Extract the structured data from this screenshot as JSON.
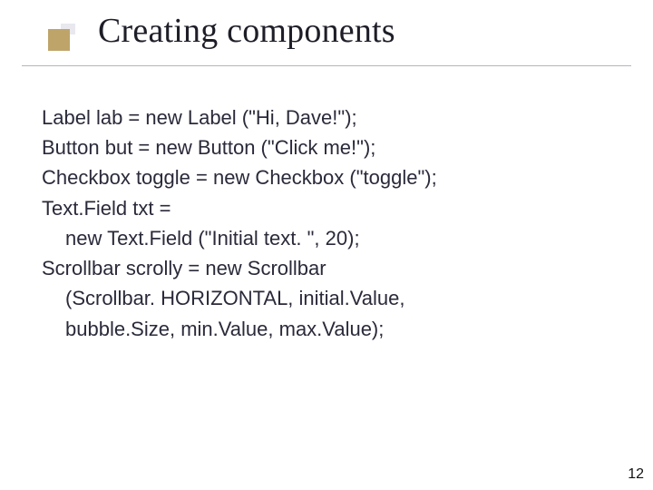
{
  "slide": {
    "title": "Creating components",
    "page_number": "12"
  },
  "code": {
    "line1": "Label lab = new Label (\"Hi, Dave!\");",
    "line2": "Button but = new Button (\"Click me!\");",
    "line3": "Checkbox toggle = new Checkbox (\"toggle\");",
    "line4": "Text.Field txt =",
    "line4b": "new Text.Field (\"Initial text. \", 20);",
    "line5": "Scrollbar scrolly = new Scrollbar",
    "line5b": "(Scrollbar. HORIZONTAL, initial.Value,",
    "line5c": " bubble.Size, min.Value, max.Value);"
  }
}
